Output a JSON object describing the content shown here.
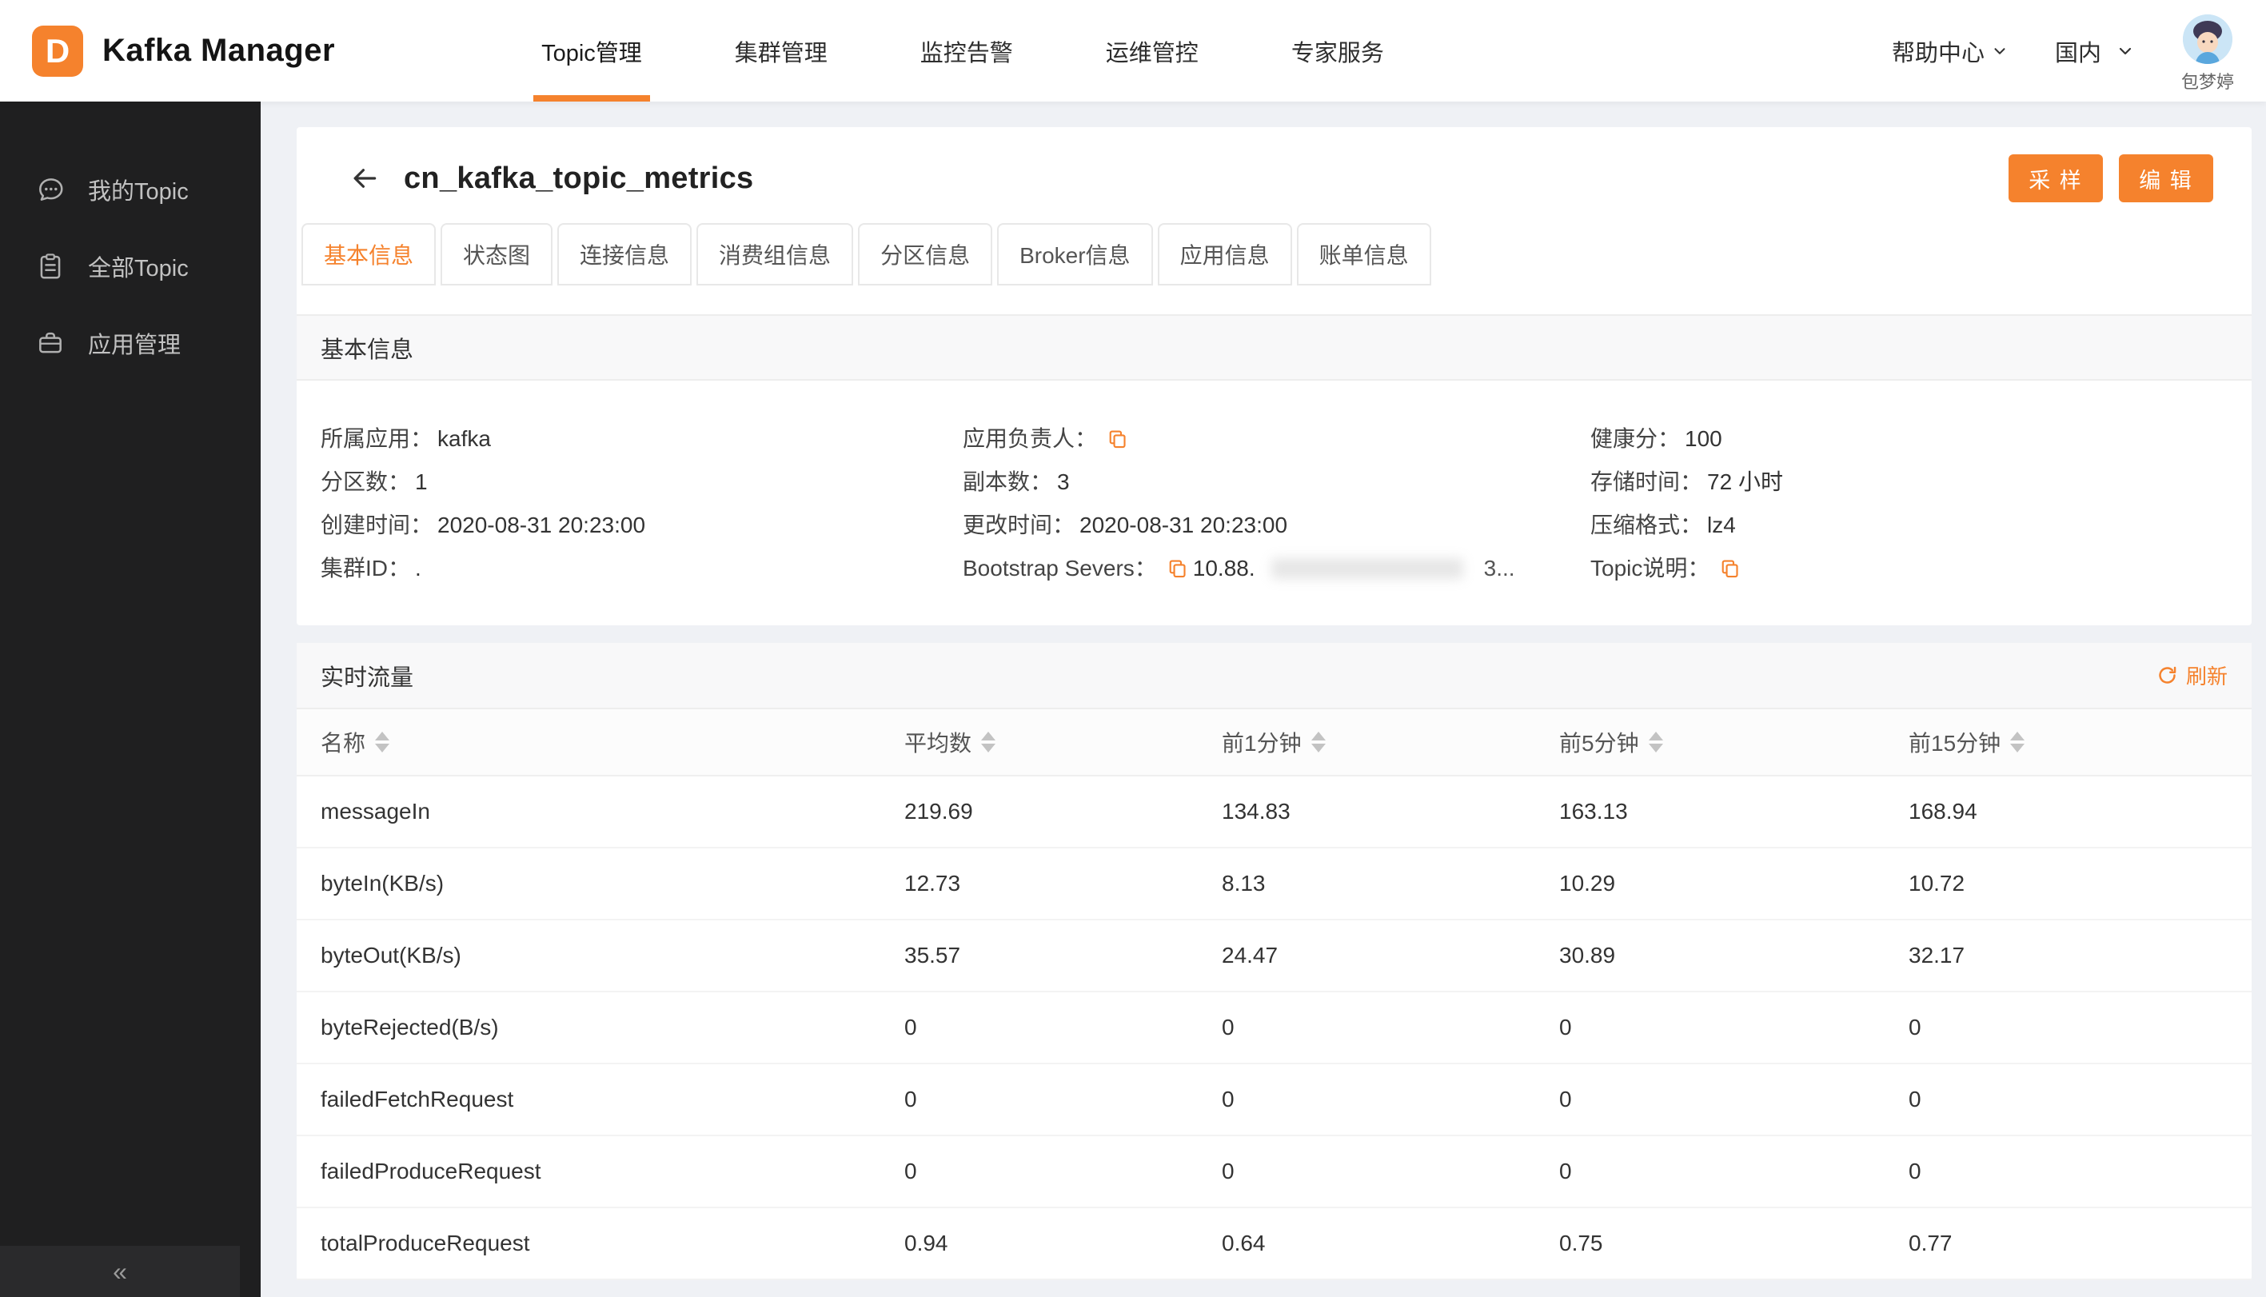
{
  "colors": {
    "accent": "#F5822D"
  },
  "navbar": {
    "brand": "Kafka Manager",
    "menu": [
      {
        "label": "Topic管理",
        "active": true
      },
      {
        "label": "集群管理",
        "active": false
      },
      {
        "label": "监控告警",
        "active": false
      },
      {
        "label": "运维管控",
        "active": false
      },
      {
        "label": "专家服务",
        "active": false
      }
    ],
    "help_label": "帮助中心",
    "region_label": "国内",
    "user_name": "包梦婷"
  },
  "sidebar": {
    "items": [
      {
        "label": "我的Topic",
        "icon": "chat-bubble-icon"
      },
      {
        "label": "全部Topic",
        "icon": "clipboard-icon"
      },
      {
        "label": "应用管理",
        "icon": "toolbox-icon"
      }
    ],
    "collapse_glyph": "«"
  },
  "page": {
    "title": "cn_kafka_topic_metrics",
    "sample_button": "采 样",
    "edit_button": "编 辑",
    "tabs": [
      {
        "label": "基本信息",
        "active": true
      },
      {
        "label": "状态图",
        "active": false
      },
      {
        "label": "连接信息",
        "active": false
      },
      {
        "label": "消费组信息",
        "active": false
      },
      {
        "label": "分区信息",
        "active": false
      },
      {
        "label": "Broker信息",
        "active": false
      },
      {
        "label": "应用信息",
        "active": false
      },
      {
        "label": "账单信息",
        "active": false
      }
    ]
  },
  "basic_info": {
    "section_title": "基本信息",
    "owner_app": {
      "label": "所属应用：",
      "value": "kafka"
    },
    "owner": {
      "label": "应用负责人："
    },
    "health": {
      "label": "健康分：",
      "value": "100"
    },
    "partitions": {
      "label": "分区数：",
      "value": "1"
    },
    "replicas": {
      "label": "副本数：",
      "value": "3"
    },
    "retention": {
      "label": "存储时间：",
      "value": "72 小时"
    },
    "create_time": {
      "label": "创建时间：",
      "value": "2020-08-31 20:23:00"
    },
    "update_time": {
      "label": "更改时间：",
      "value": "2020-08-31 20:23:00"
    },
    "compression": {
      "label": "压缩格式：",
      "value": "lz4"
    },
    "cluster_id": {
      "label": "集群ID：",
      "value": "."
    },
    "bootstrap": {
      "label": "Bootstrap Severs：",
      "value_prefix": "10.88.",
      "value_suffix": "3..."
    },
    "topic_desc": {
      "label": "Topic说明："
    }
  },
  "realtime": {
    "section_title": "实时流量",
    "refresh_label": "刷新",
    "table": {
      "columns": [
        "名称",
        "平均数",
        "前1分钟",
        "前5分钟",
        "前15分钟"
      ],
      "rows": [
        {
          "cells": [
            "messageIn",
            "219.69",
            "134.83",
            "163.13",
            "168.94"
          ]
        },
        {
          "cells": [
            "byteIn(KB/s)",
            "12.73",
            "8.13",
            "10.29",
            "10.72"
          ]
        },
        {
          "cells": [
            "byteOut(KB/s)",
            "35.57",
            "24.47",
            "30.89",
            "32.17"
          ]
        },
        {
          "cells": [
            "byteRejected(B/s)",
            "0",
            "0",
            "0",
            "0"
          ]
        },
        {
          "cells": [
            "failedFetchRequest",
            "0",
            "0",
            "0",
            "0"
          ]
        },
        {
          "cells": [
            "failedProduceRequest",
            "0",
            "0",
            "0",
            "0"
          ]
        },
        {
          "cells": [
            "totalProduceRequest",
            "0.94",
            "0.64",
            "0.75",
            "0.77"
          ]
        }
      ]
    }
  }
}
